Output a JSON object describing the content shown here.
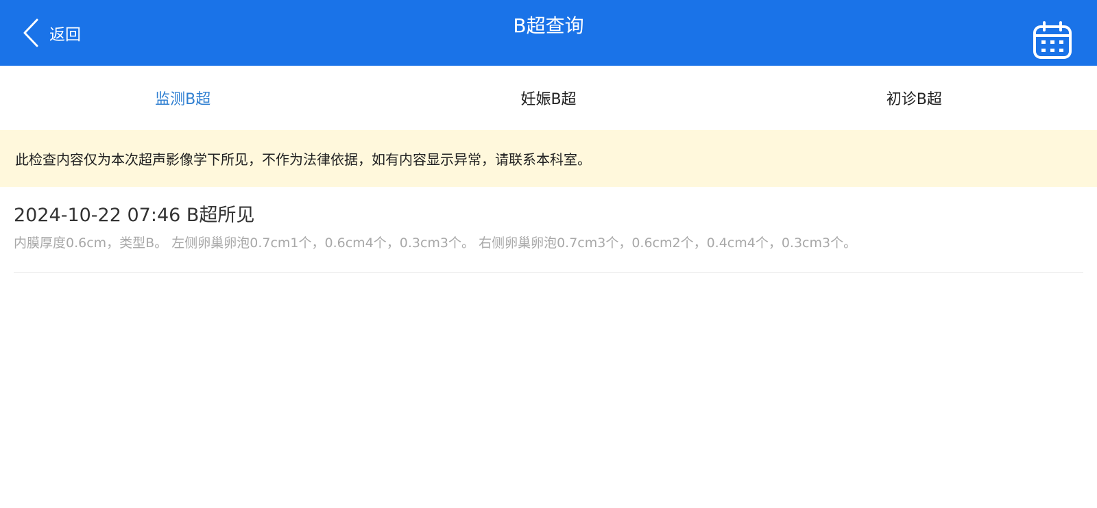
{
  "header": {
    "back_label": "返回",
    "title": "B超查询",
    "back_icon": "chevron-left-icon",
    "calendar_icon": "calendar-icon",
    "background_color": "#1a73e8"
  },
  "tabs": [
    {
      "label": "监测B超",
      "active": true
    },
    {
      "label": "妊娠B超",
      "active": false
    },
    {
      "label": "初诊B超",
      "active": false
    }
  ],
  "notice": {
    "text": "此检查内容仅为本次超声影像学下所见，不作为法律依据，如有内容显示异常，请联系本科室。",
    "background_color": "#fff8dc"
  },
  "records": [
    {
      "title": "2024-10-22 07:46 B超所见",
      "description": "内膜厚度0.6cm，类型B。 左侧卵巢卵泡0.7cm1个，0.6cm4个，0.3cm3个。 右侧卵巢卵泡0.7cm3个，0.6cm2个，0.4cm4个，0.3cm3个。"
    }
  ]
}
